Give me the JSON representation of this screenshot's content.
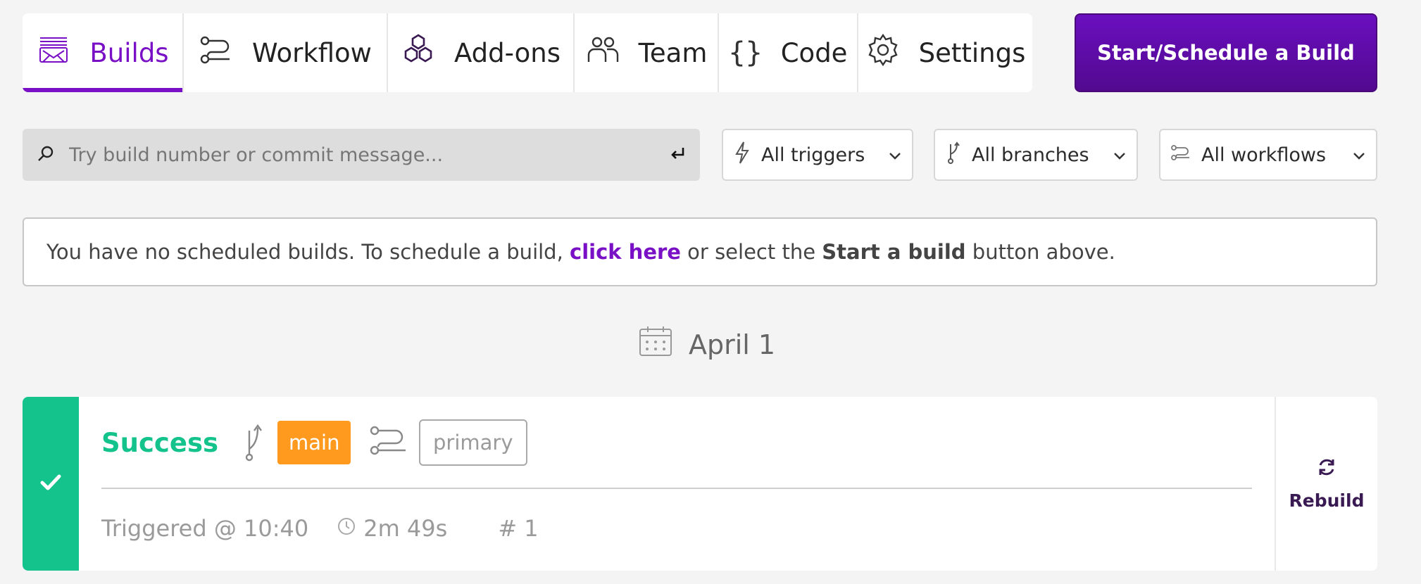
{
  "tabs": [
    {
      "label": "Builds",
      "icon": "builds-icon",
      "active": true
    },
    {
      "label": "Workflow",
      "icon": "workflow-icon"
    },
    {
      "label": "Add-ons",
      "icon": "addons-icon"
    },
    {
      "label": "Team",
      "icon": "team-icon"
    },
    {
      "label": "Code",
      "icon": "code-braces-icon"
    },
    {
      "label": "Settings",
      "icon": "gear-icon"
    }
  ],
  "start_button": "Start/Schedule a Build",
  "search": {
    "placeholder": "Try build number or commit message...",
    "value": ""
  },
  "filters": {
    "triggers": "All triggers",
    "branches": "All branches",
    "workflows": "All workflows"
  },
  "notice": {
    "prefix": "You have no scheduled builds. To schedule a build, ",
    "link": "click here",
    "middle": " or select the ",
    "bold": "Start a build",
    "suffix": " button above."
  },
  "date_header": "April 1",
  "build": {
    "status": "Success",
    "branch": "main",
    "workflow": "primary",
    "triggered": "Triggered @ 10:40",
    "duration": "2m 49s",
    "number": "# 1",
    "rebuild_label": "Rebuild"
  },
  "colors": {
    "accent": "#7a10c6",
    "success": "#13c38b",
    "branch_badge": "#ff9a1f",
    "button": "#6a0fbf"
  }
}
